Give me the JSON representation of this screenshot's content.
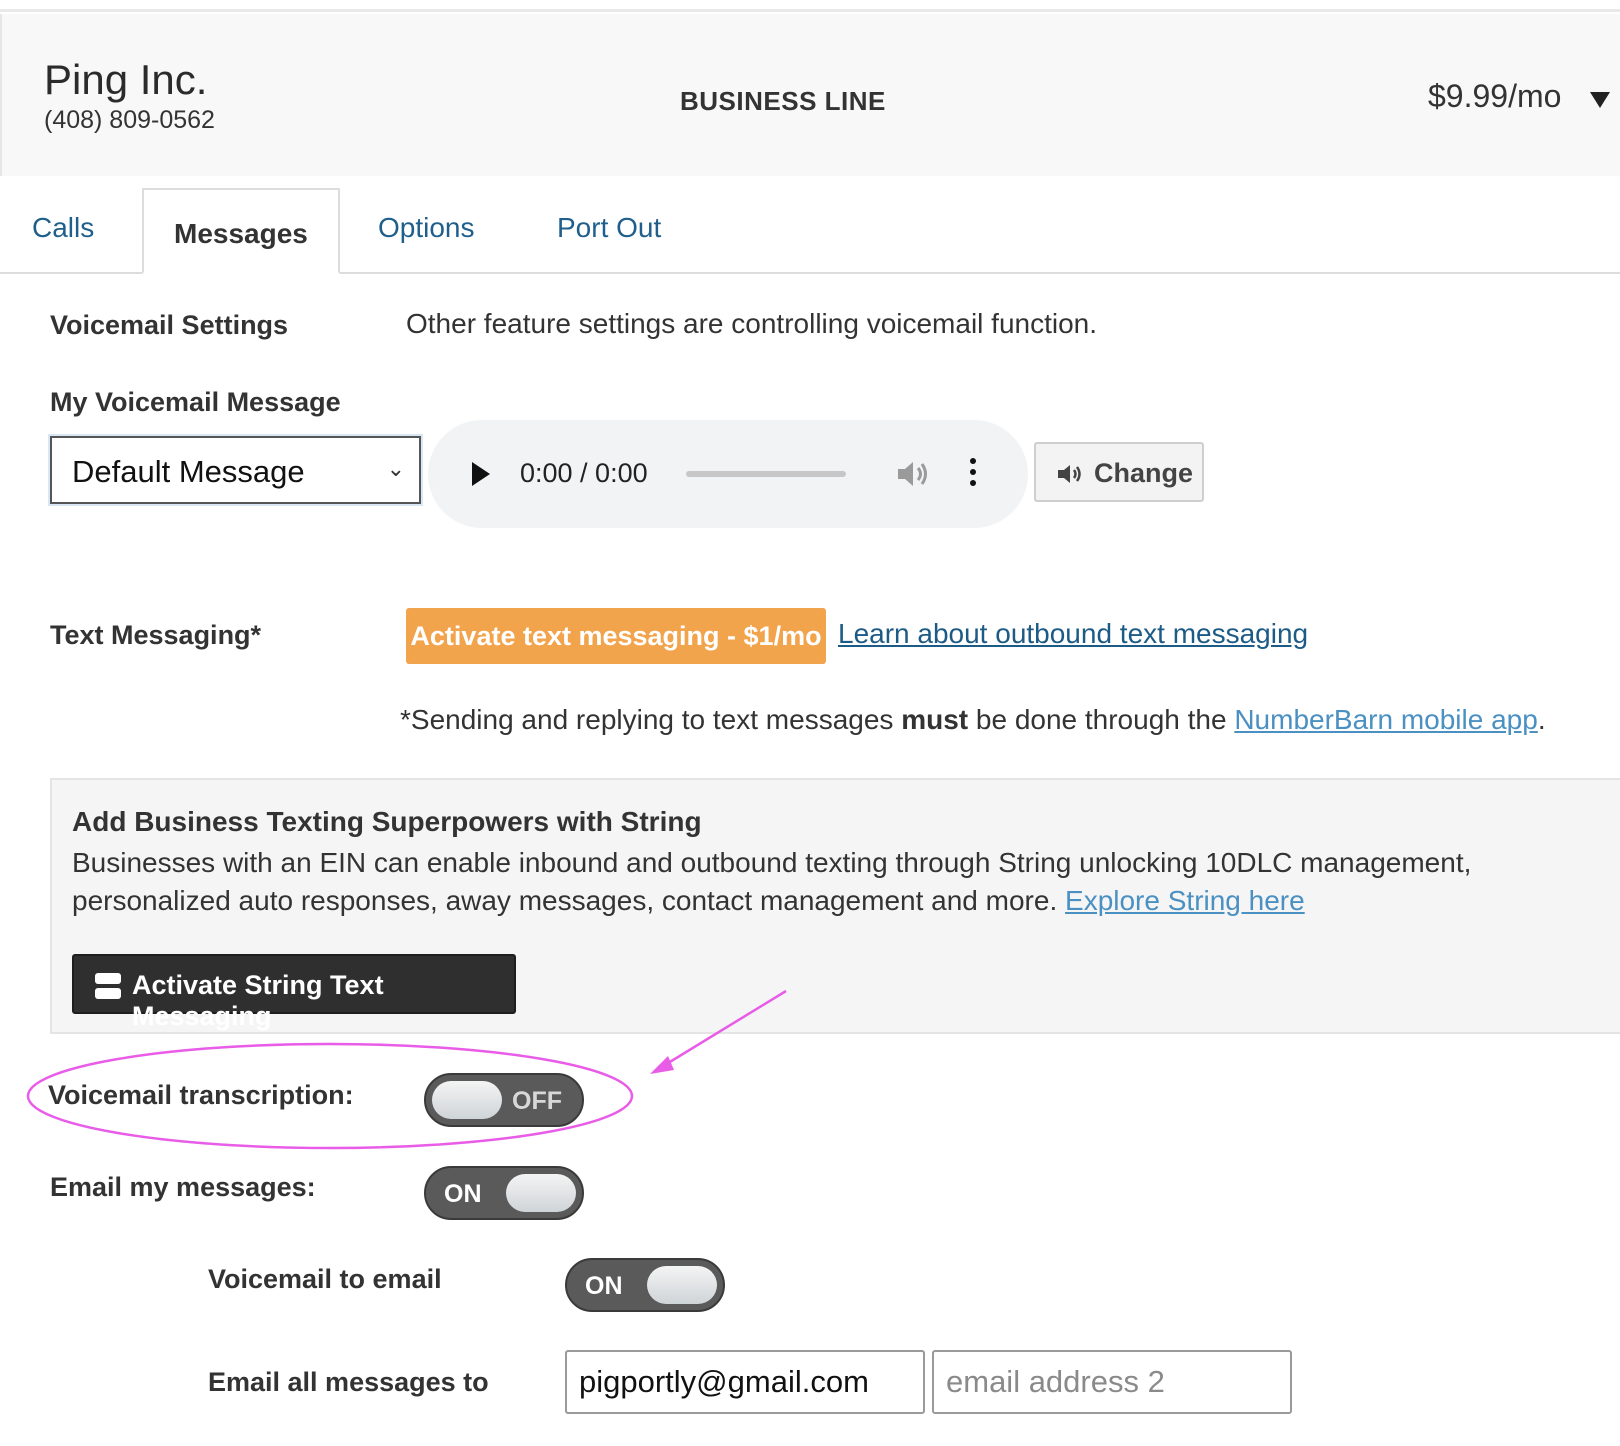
{
  "header": {
    "company": "Ping Inc.",
    "phone": "(408) 809-0562",
    "line_type": "BUSINESS LINE",
    "price": "$9.99/mo"
  },
  "tabs": [
    {
      "label": "Calls",
      "active": false
    },
    {
      "label": "Messages",
      "active": true
    },
    {
      "label": "Options",
      "active": false
    },
    {
      "label": "Port Out",
      "active": false
    }
  ],
  "voicemail": {
    "settings_label": "Voicemail Settings",
    "settings_note": "Other feature settings are controlling voicemail function.",
    "message_label": "My Voicemail Message",
    "message_selected": "Default Message",
    "player_time": "0:00 / 0:00",
    "change_label": "Change"
  },
  "text_messaging": {
    "label": "Text Messaging*",
    "activate_label": "Activate text messaging - $1/mo",
    "learn_link": "Learn about outbound text messaging",
    "note_prefix": "*Sending and replying to text messages ",
    "note_bold": "must",
    "note_middle": " be done through the ",
    "note_link": "NumberBarn mobile app",
    "note_suffix": "."
  },
  "string_panel": {
    "title": "Add Business Texting Superpowers with String",
    "body": "Businesses with an EIN can enable inbound and outbound texting through String unlocking 10DLC management, personalized auto responses, away messages, contact management and more. ",
    "link": "Explore String here",
    "button_label": "Activate String Text Messaging"
  },
  "settings": {
    "transcription_label": "Voicemail transcription:",
    "transcription_state": "OFF",
    "email_label": "Email my messages:",
    "email_state": "ON",
    "vm_email_label": "Voicemail to email",
    "vm_email_state": "ON",
    "email_to_label": "Email all messages to",
    "email1_value": "pigportly@gmail.com",
    "email2_placeholder": "email address 2"
  },
  "colors": {
    "accent_orange": "#f2a44d",
    "link_blue": "#1f6f9f",
    "annotation_magenta": "#e85ce8"
  }
}
